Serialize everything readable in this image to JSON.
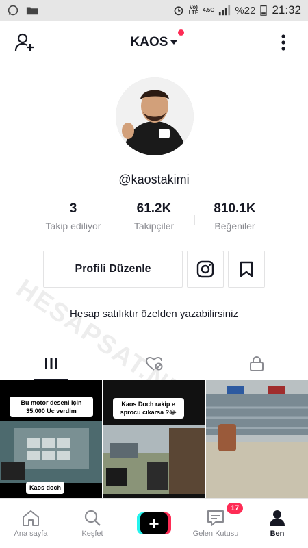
{
  "status_bar": {
    "volte": "Vo)",
    "lte": "LTE",
    "net": "4.5G",
    "battery": "%22",
    "time": "21:32"
  },
  "header": {
    "title": "KAOS"
  },
  "profile": {
    "username": "@kaostakimi",
    "stats": [
      {
        "value": "3",
        "label": "Takip ediliyor"
      },
      {
        "value": "61.2K",
        "label": "Takipçiler"
      },
      {
        "value": "810.1K",
        "label": "Beğeniler"
      }
    ],
    "edit_label": "Profili Düzenle",
    "bio": "Hesap satılıktır özelden yazabilirsiniz"
  },
  "videos": [
    {
      "caption": "Bu motor deseni için 35.000 Uc verdim",
      "caption2": "Kaos doch"
    },
    {
      "caption": "Kaos Doch rakip e sprocu cıkarsa ?😂"
    },
    {
      "caption": ""
    }
  ],
  "watermark": "HESAPSAT.NET",
  "bottom_nav": {
    "home": "Ana sayfa",
    "discover": "Keşfet",
    "inbox": "Gelen Kutusu",
    "inbox_badge": "17",
    "me": "Ben"
  },
  "colors": {
    "accent": "#fe2c55",
    "cyan": "#25f4ee",
    "text": "#161823",
    "muted": "#8a8b91"
  }
}
